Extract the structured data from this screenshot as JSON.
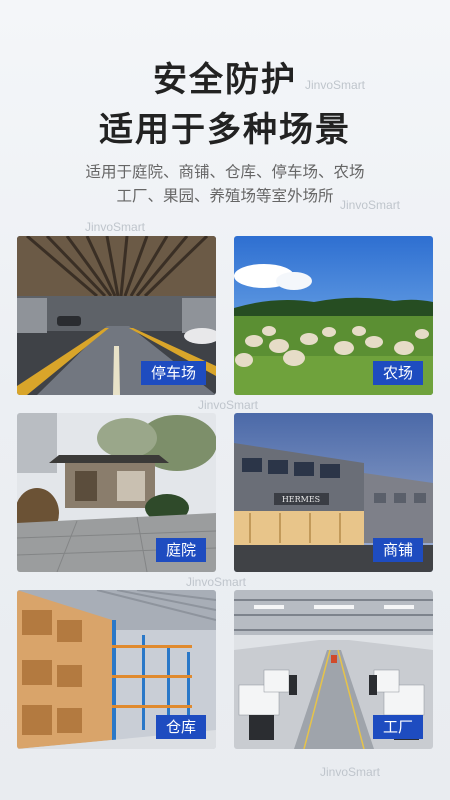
{
  "header": {
    "title_line1": "安全防护",
    "title_line2": "适用于多种场景",
    "subtitle_line1": "适用于庭院、商铺、仓库、停车场、农场",
    "subtitle_line2": "工厂、果园、养殖场等室外场所"
  },
  "watermark": "JinvoSmart",
  "scenes": [
    {
      "label": "停车场",
      "icon": "parking-garage-photo"
    },
    {
      "label": "农场",
      "icon": "sheep-farm-photo"
    },
    {
      "label": "庭院",
      "icon": "courtyard-photo"
    },
    {
      "label": "商铺",
      "icon": "storefront-photo"
    },
    {
      "label": "仓库",
      "icon": "warehouse-photo"
    },
    {
      "label": "工厂",
      "icon": "factory-photo"
    }
  ],
  "colors": {
    "label_bg": "#1e4cc0",
    "title": "#222222"
  },
  "store_sign": "HERMES"
}
